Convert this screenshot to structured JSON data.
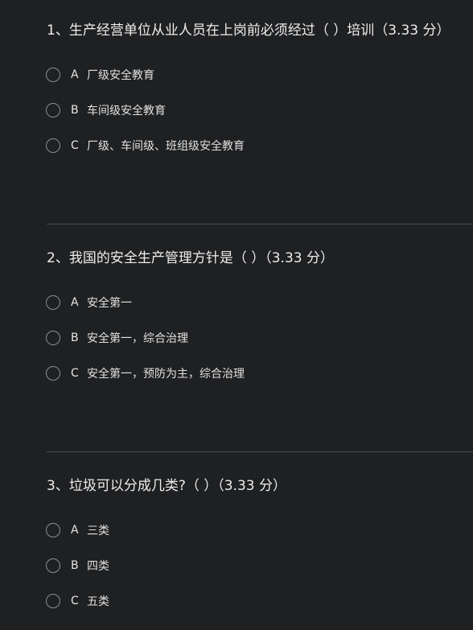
{
  "questions": [
    {
      "title": "1、生产经营单位从业人员在上岗前必须经过（ ）培训（3.33 分）",
      "options": [
        {
          "letter": "A",
          "text": "厂级安全教育"
        },
        {
          "letter": "B",
          "text": "车间级安全教育"
        },
        {
          "letter": "C",
          "text": "厂级、车间级、班组级安全教育"
        }
      ]
    },
    {
      "title": "2、我国的安全生产管理方针是（ ）（3.33 分）",
      "options": [
        {
          "letter": "A",
          "text": "安全第一"
        },
        {
          "letter": "B",
          "text": "安全第一，综合治理"
        },
        {
          "letter": "C",
          "text": "安全第一，预防为主，综合治理"
        }
      ]
    },
    {
      "title": "3、垃圾可以分成几类?（ ）（3.33 分）",
      "options": [
        {
          "letter": "A",
          "text": "三类"
        },
        {
          "letter": "B",
          "text": "四类"
        },
        {
          "letter": "C",
          "text": "五类"
        }
      ]
    }
  ]
}
